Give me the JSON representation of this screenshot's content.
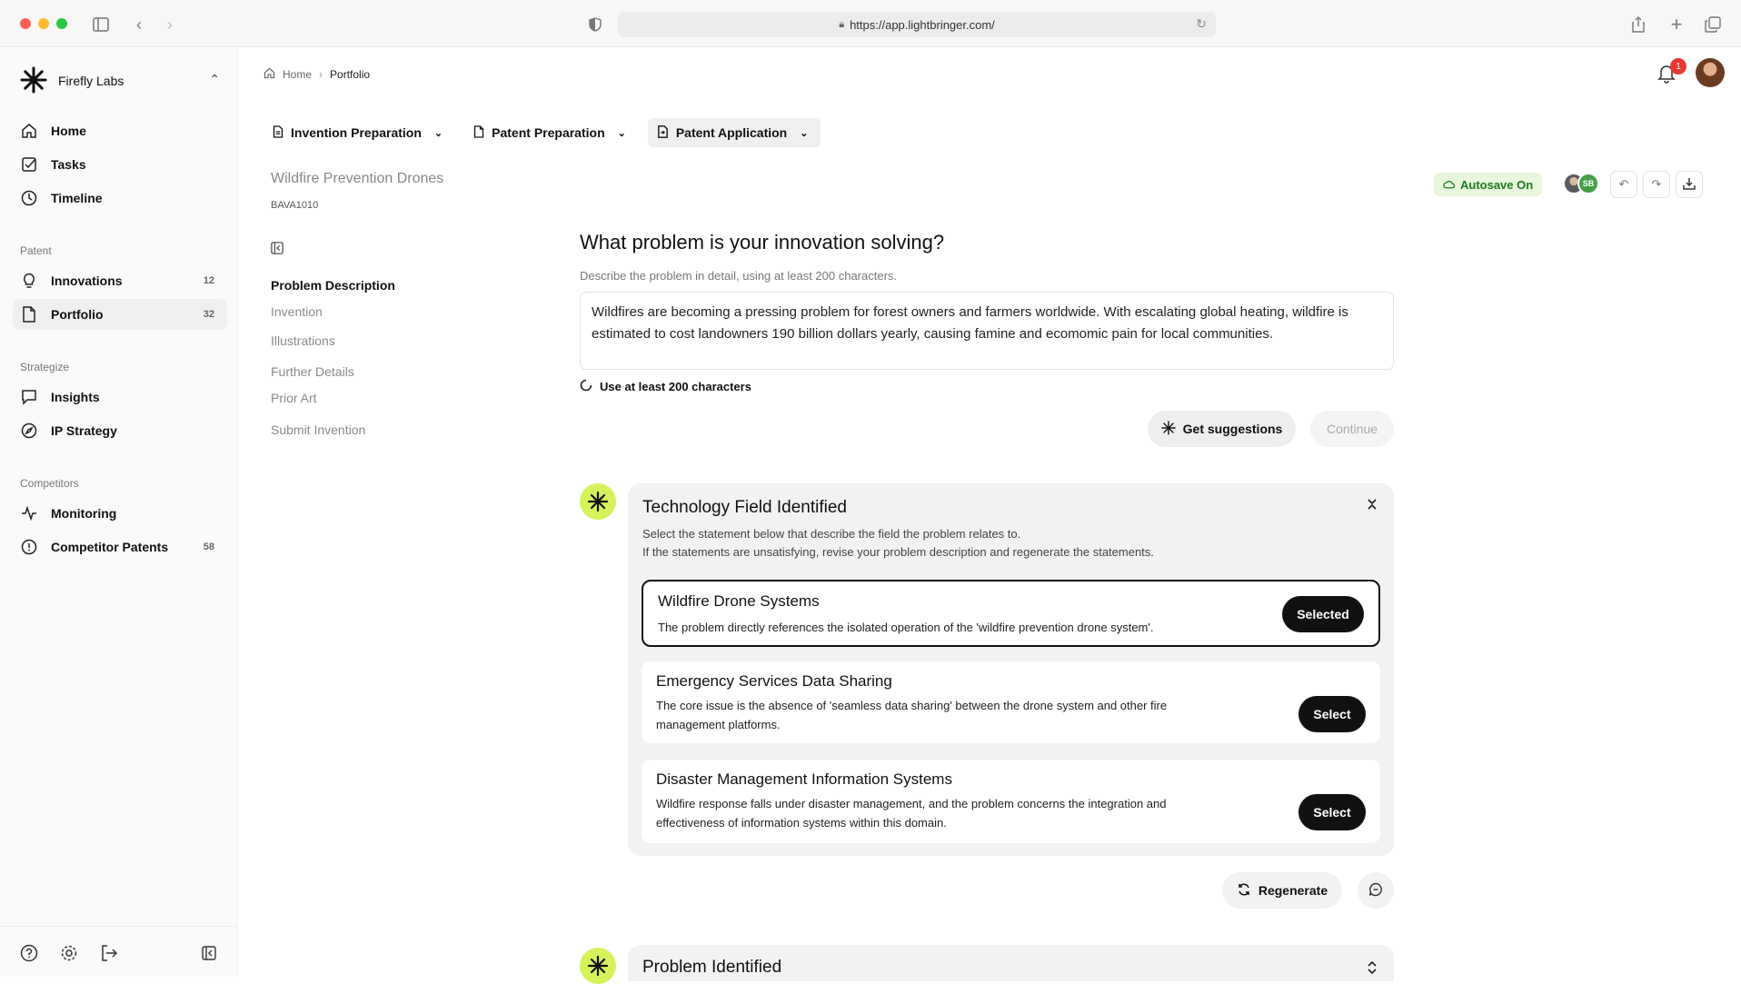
{
  "browser": {
    "url": "https://app.lightbringer.com/",
    "traffic_colors": [
      "#ff5f57",
      "#febc2e",
      "#28c840"
    ]
  },
  "org": {
    "name": "Firefly Labs"
  },
  "sidebar": {
    "items_top": [
      {
        "label": "Home",
        "icon": "home-icon"
      },
      {
        "label": "Tasks",
        "icon": "checkbox-icon"
      },
      {
        "label": "Timeline",
        "icon": "clock-icon"
      }
    ],
    "patent_label": "Patent",
    "patent_items": [
      {
        "label": "Innovations",
        "count": "12",
        "icon": "lightbulb-icon"
      },
      {
        "label": "Portfolio",
        "count": "32",
        "icon": "document-icon"
      }
    ],
    "strategize_label": "Strategize",
    "strategize_items": [
      {
        "label": "Insights",
        "icon": "chat-icon"
      },
      {
        "label": "IP Strategy",
        "icon": "compass-icon"
      }
    ],
    "competitors_label": "Competitors",
    "competitor_items": [
      {
        "label": "Monitoring",
        "icon": "pulse-icon"
      },
      {
        "label": "Competitor Patents",
        "count": "58",
        "icon": "alert-circle-icon"
      }
    ]
  },
  "breadcrumb": {
    "home": "Home",
    "current": "Portfolio"
  },
  "notifications": {
    "count": "1"
  },
  "stage_tabs": [
    {
      "label": "Invention Preparation"
    },
    {
      "label": "Patent Preparation"
    },
    {
      "label": "Patent Application"
    }
  ],
  "project": {
    "title": "Wildfire Prevention Drones",
    "code": "BAVA1010"
  },
  "steps": [
    "Problem Description",
    "Invention",
    "Illustrations",
    "Further Details",
    "Prior Art",
    "Submit Invention"
  ],
  "autosave": {
    "label": "Autosave On"
  },
  "collaborators": {
    "initials": "SB"
  },
  "question": {
    "title": "What problem is your innovation solving?",
    "hint": "Describe the problem in detail, using at least 200 characters.",
    "answer": "Wildfires are becoming a pressing problem for forest owners and farmers worldwide. With escalating global heating, wildfire is estimated to cost landowners 190 billion dollars yearly, causing famine and ecomomic pain for local communities.",
    "char_hint": "Use at least 200 characters",
    "suggest_label": "Get suggestions",
    "continue_label": "Continue"
  },
  "tech_field": {
    "title": "Technology Field Identified",
    "desc_line1": "Select the statement below that describe the field the problem relates to.",
    "desc_line2": "If the statements are unsatisfying, revise your problem description and regenerate the statements.",
    "options": [
      {
        "title": "Wildfire Drone Systems",
        "desc": "The problem directly references the isolated operation of the 'wildfire prevention drone system'.",
        "button": "Selected"
      },
      {
        "title": "Emergency Services Data Sharing",
        "desc": "The core issue is the absence of 'seamless data sharing' between the drone system and other fire management platforms.",
        "button": "Select"
      },
      {
        "title": "Disaster Management Information Systems",
        "desc": "Wildfire response falls under disaster management, and the problem concerns the integration and effectiveness of information systems within this domain.",
        "button": "Select"
      }
    ],
    "regenerate_label": "Regenerate"
  },
  "problem_panel": {
    "title": "Problem Identified"
  },
  "colors": {
    "accent": "#d6f25a",
    "autosave_bg": "#e7f6dc",
    "autosave_text": "#1f7a1f",
    "badge": "#e53935"
  }
}
